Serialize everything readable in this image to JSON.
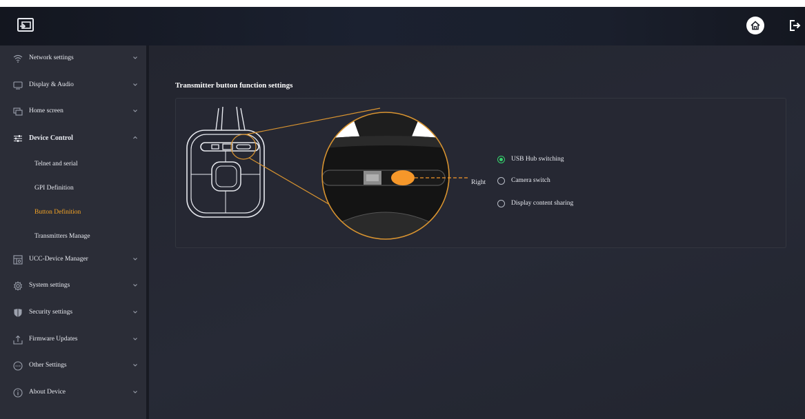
{
  "header": {
    "logo_icon": "screen-share-icon",
    "home_icon": "home-icon",
    "logout_icon": "logout-icon"
  },
  "sidebar": {
    "items": [
      {
        "label": "Network settings",
        "icon": "wifi-icon",
        "expanded": false
      },
      {
        "label": "Display & Audio",
        "icon": "monitor-icon",
        "expanded": false
      },
      {
        "label": "Home screen",
        "icon": "windows-icon",
        "expanded": false
      },
      {
        "label": "Device Control",
        "icon": "sliders-icon",
        "expanded": true,
        "children": [
          {
            "label": "Telnet and serial",
            "active": false
          },
          {
            "label": "GPI Definition",
            "active": false
          },
          {
            "label": "Button Definition",
            "active": true
          },
          {
            "label": "Transmitters Manage",
            "active": false
          }
        ]
      },
      {
        "label": "UCC-Device Manager",
        "icon": "device-manager-icon",
        "expanded": false
      },
      {
        "label": "System settings",
        "icon": "gear-icon",
        "expanded": false
      },
      {
        "label": "Security settings",
        "icon": "shield-icon",
        "expanded": false
      },
      {
        "label": "Firmware Updates",
        "icon": "upload-icon",
        "expanded": false
      },
      {
        "label": "Other Settings",
        "icon": "more-circle-icon",
        "expanded": false
      },
      {
        "label": "About Device",
        "icon": "info-icon",
        "expanded": false
      }
    ]
  },
  "main": {
    "title": "Transmitter button function settings",
    "button_position_label": "Right",
    "options": [
      {
        "label": "USB Hub switching",
        "selected": true
      },
      {
        "label": "Camera switch",
        "selected": false
      },
      {
        "label": "Display content sharing",
        "selected": false
      }
    ]
  },
  "colors": {
    "accent": "#f5a425",
    "selected_radio": "#36d36d",
    "background": "#22242e",
    "sidebar": "#2b2d37"
  }
}
